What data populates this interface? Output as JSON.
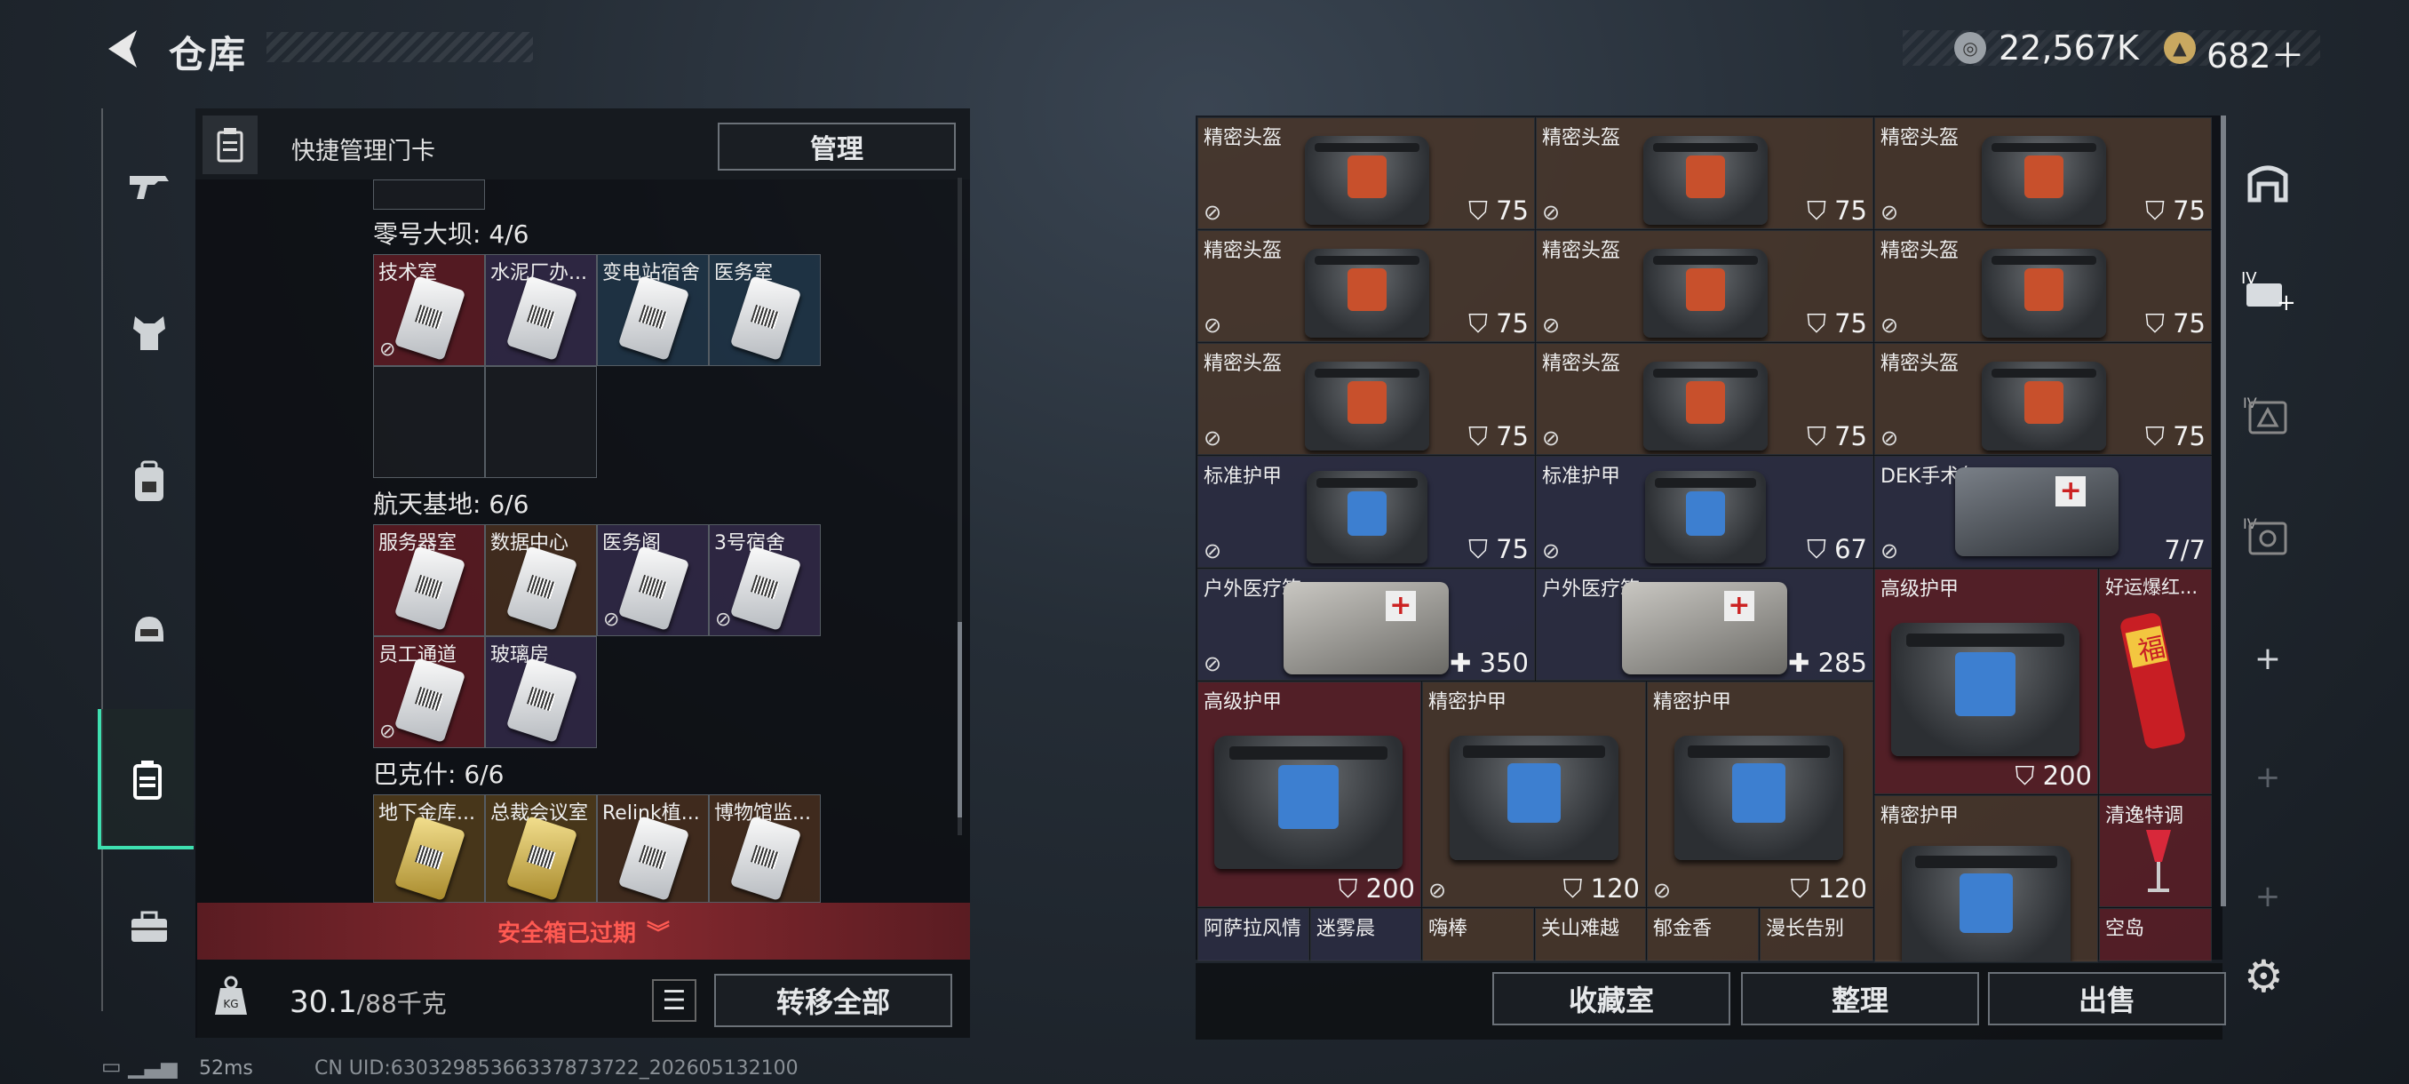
{
  "header": {
    "title": "仓库",
    "currency_silver": "22,567K",
    "currency_gold": "682＋"
  },
  "left_panel": {
    "quick_title": "快捷管理门卡",
    "manage_label": "管理",
    "sections": [
      {
        "title": "零号大坝: 4/6",
        "cards": [
          "技术室",
          "水泥厂办...",
          "变电站宿舍",
          "医务室"
        ]
      },
      {
        "title": "航天基地: 6/6",
        "cards": [
          "服务器室",
          "数据中心",
          "医务阁",
          "3号宿舍",
          "员工通道",
          "玻璃房"
        ]
      },
      {
        "title": "巴克什: 6/6",
        "cards": [
          "地下金库...",
          "总裁会议室",
          "Relink植...",
          "博物馆监..."
        ]
      }
    ],
    "expired_label": "安全箱已过期",
    "weight_value": "30.1",
    "weight_total": "/88千克",
    "transfer_label": "转移全部"
  },
  "stash": {
    "items": [
      {
        "name": "精密头盔",
        "value": "75"
      },
      {
        "name": "精密头盔",
        "value": "75"
      },
      {
        "name": "精密头盔",
        "value": "75"
      },
      {
        "name": "精密头盔",
        "value": "75"
      },
      {
        "name": "精密头盔",
        "value": "75"
      },
      {
        "name": "精密头盔",
        "value": "75"
      },
      {
        "name": "精密头盔",
        "value": "75"
      },
      {
        "name": "精密头盔",
        "value": "75"
      },
      {
        "name": "精密头盔",
        "value": "75"
      },
      {
        "name": "标准护甲",
        "value": "75"
      },
      {
        "name": "标准护甲",
        "value": "67"
      },
      {
        "name": "DEK手术包",
        "value": "7/7"
      },
      {
        "name": "户外医疗箱",
        "value": "350"
      },
      {
        "name": "户外医疗箱",
        "value": "285"
      },
      {
        "name": "高级护甲",
        "value": "200"
      },
      {
        "name": "好运爆红..."
      },
      {
        "name": "高级护甲",
        "value": "200"
      },
      {
        "name": "精密护甲",
        "value": "120"
      },
      {
        "name": "精密护甲",
        "value": "120"
      },
      {
        "name": "精密护甲"
      },
      {
        "name": "清逸特调"
      },
      {
        "name": "阿萨拉风情"
      },
      {
        "name": "迷雾晨"
      },
      {
        "name": "嗨棒"
      },
      {
        "name": "关山难越"
      },
      {
        "name": "郁金香"
      },
      {
        "name": "漫长告别"
      },
      {
        "name": "空岛"
      }
    ]
  },
  "bottom_buttons": {
    "collection": "收藏室",
    "organize": "整理",
    "sell": "出售"
  },
  "status_bar": {
    "ping": "52ms",
    "uid": "CN UID:6303298536633787372​2_202605132100"
  },
  "icons": {
    "nav": [
      "gun-icon",
      "armor-icon",
      "backpack-icon",
      "helmet-icon",
      "keycard-icon",
      "toolbox-icon"
    ]
  }
}
